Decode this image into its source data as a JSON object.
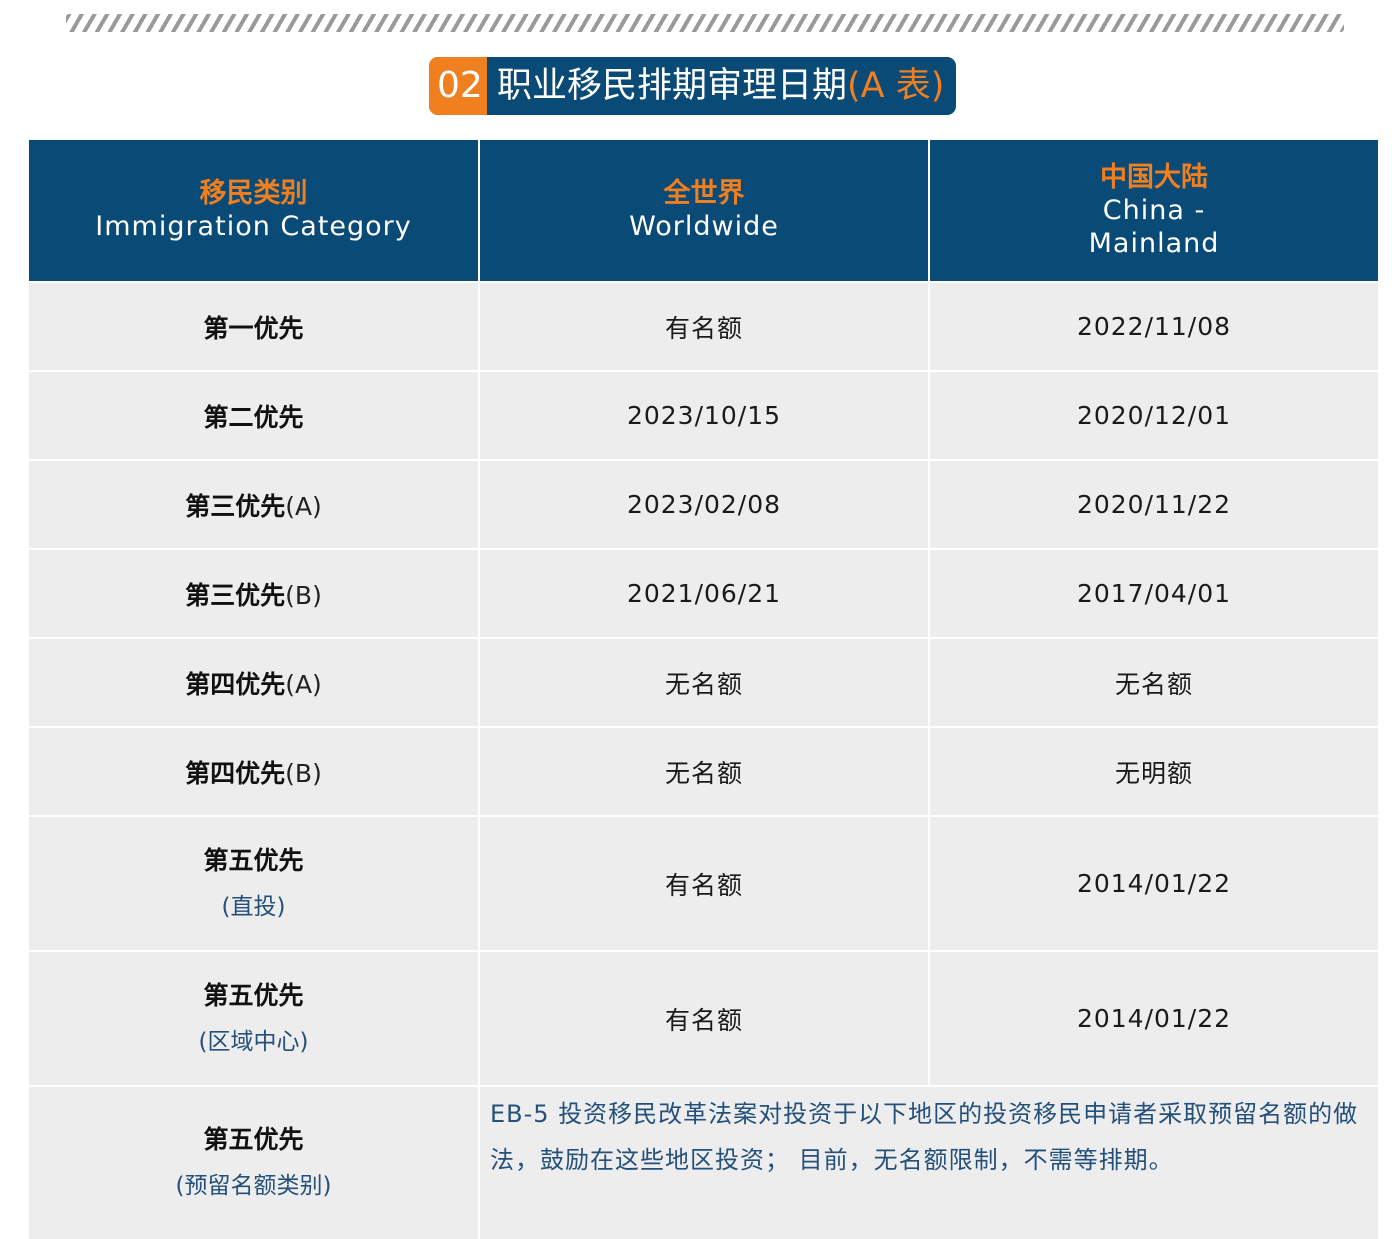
{
  "header": {
    "number": "02",
    "title": "职业移民排期审理日期",
    "title_suffix": "(A 表)"
  },
  "table": {
    "columns": [
      {
        "zh": "移民类别",
        "en": "Immigration Category"
      },
      {
        "zh": "全世界",
        "en": "Worldwide"
      },
      {
        "zh": "中国大陆",
        "en": "China - Mainland"
      }
    ],
    "rows": [
      {
        "category": "第一优先",
        "suffix": "",
        "worldwide": "有名额",
        "china": "2022/11/08"
      },
      {
        "category": "第二优先",
        "suffix": "",
        "worldwide": "2023/10/15",
        "china": "2020/12/01"
      },
      {
        "category": "第三优先",
        "suffix": "(A)",
        "worldwide": "2023/02/08",
        "china": "2020/11/22"
      },
      {
        "category": "第三优先",
        "suffix": "(B)",
        "worldwide": "2021/06/21",
        "china": "2017/04/01"
      },
      {
        "category": "第四优先",
        "suffix": "(A)",
        "worldwide": "无名额",
        "china": "无名额"
      },
      {
        "category": "第四优先",
        "suffix": "(B)",
        "worldwide": "无名额",
        "china": "无明额"
      },
      {
        "category": "第五优先",
        "sub": "(直投)",
        "worldwide": "有名额",
        "china": "2014/01/22"
      },
      {
        "category": "第五优先",
        "sub": "(区域中心)",
        "worldwide": "有名额",
        "china": "2014/01/22"
      },
      {
        "category": "第五优先",
        "sub": "(预留名额类别)",
        "note": "EB-5 投资移民改革法案对投资于以下地区的投资移民申请者采取预留名额的做法，鼓励在这些地区投资； 目前，无名额限制，不需等排期。"
      }
    ]
  },
  "colors": {
    "navy": "#0a4a76",
    "orange": "#f07f1f",
    "row_bg": "#ededed",
    "note_text": "#24507a"
  }
}
